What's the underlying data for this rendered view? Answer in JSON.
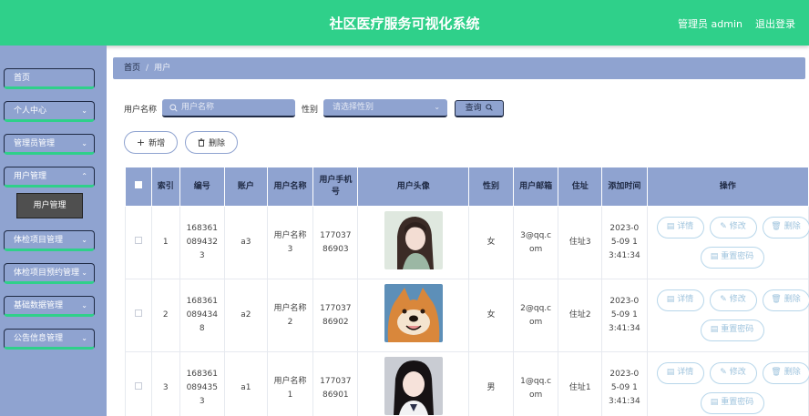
{
  "header": {
    "title": "社区医疗服务可视化系统",
    "user": "管理员 admin",
    "logout": "退出登录"
  },
  "sidebar": {
    "items": [
      {
        "label": "首页",
        "chev": ""
      },
      {
        "label": "个人中心",
        "chev": "⌄"
      },
      {
        "label": "管理员管理",
        "chev": "⌄"
      },
      {
        "label": "用户管理",
        "chev": "⌃"
      },
      {
        "label": "体检项目管理",
        "chev": "⌄"
      },
      {
        "label": "体检项目预约管理",
        "chev": "⌄"
      },
      {
        "label": "基础数据管理",
        "chev": "⌄"
      },
      {
        "label": "公告信息管理",
        "chev": "⌄"
      }
    ],
    "submenu": {
      "label": "用户管理"
    }
  },
  "breadcrumb": {
    "home": "首页",
    "sep": "/",
    "current": "用户"
  },
  "search": {
    "name_label": "用户名称",
    "name_placeholder": "用户名称",
    "gender_label": "性别",
    "gender_placeholder": "请选择性别",
    "query_label": "查询"
  },
  "actions": {
    "add_label": "新增",
    "delete_label": "删除"
  },
  "table": {
    "headers": [
      "索引",
      "编号",
      "账户",
      "用户名称",
      "用户手机号",
      "用户头像",
      "性别",
      "用户邮箱",
      "住址",
      "添加时间",
      "操作"
    ],
    "rows": [
      {
        "index": "1",
        "id": "1683610894323",
        "account": "a3",
        "name": "用户名称3",
        "phone": "17703786903",
        "gender": "女",
        "email": "3@qq.com",
        "address": "住址3",
        "time": "2023-05-09 13:41:34"
      },
      {
        "index": "2",
        "id": "1683610894348",
        "account": "a2",
        "name": "用户名称2",
        "phone": "17703786902",
        "gender": "女",
        "email": "2@qq.com",
        "address": "住址2",
        "time": "2023-05-09 13:41:34"
      },
      {
        "index": "3",
        "id": "1683610894353",
        "account": "a1",
        "name": "用户名称1",
        "phone": "17703786901",
        "gender": "男",
        "email": "1@qq.com",
        "address": "住址1",
        "time": "2023-05-09 13:41:34"
      }
    ],
    "op_labels": {
      "detail": "详情",
      "edit": "修改",
      "delete": "删除",
      "reset": "重置密码"
    }
  },
  "icons": [
    "search-icon",
    "plus-icon",
    "trash-icon",
    "chevron-down-icon",
    "chevron-up-icon",
    "doc-icon",
    "pen-icon"
  ]
}
